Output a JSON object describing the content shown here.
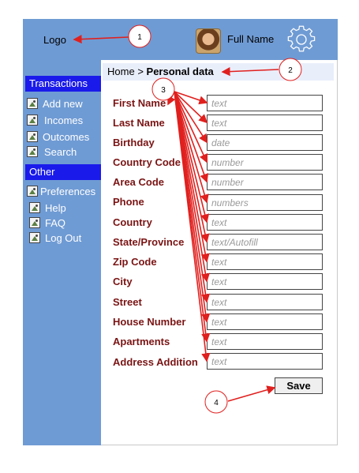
{
  "header": {
    "logo": "Logo",
    "user_name": "Full Name"
  },
  "sidebar": {
    "transactions_title": "Transactions",
    "transactions": [
      "Add new",
      "Incomes",
      "Outcomes",
      "Search"
    ],
    "other_title": "Other",
    "other": [
      "Preferences",
      "Help",
      "FAQ",
      "Log Out"
    ]
  },
  "breadcrumb": {
    "home": "Home",
    "separator": ">",
    "current": "Personal data"
  },
  "form": {
    "fields": [
      {
        "label": "First Name",
        "placeholder": "text"
      },
      {
        "label": "Last Name",
        "placeholder": "text"
      },
      {
        "label": "Birthday",
        "placeholder": "date"
      },
      {
        "label": "Country Code",
        "placeholder": "number"
      },
      {
        "label": "Area Code",
        "placeholder": "number"
      },
      {
        "label": "Phone",
        "placeholder": "numbers"
      },
      {
        "label": "Country",
        "placeholder": "text"
      },
      {
        "label": "State/Province",
        "placeholder": "text/Autofill"
      },
      {
        "label": "Zip Code",
        "placeholder": "text"
      },
      {
        "label": "City",
        "placeholder": "text"
      },
      {
        "label": "Street",
        "placeholder": "text"
      },
      {
        "label": "House Number",
        "placeholder": "text"
      },
      {
        "label": "Apartments",
        "placeholder": "text"
      },
      {
        "label": "Address Addition",
        "placeholder": "text"
      }
    ],
    "save_label": "Save"
  },
  "annotations": [
    "1",
    "2",
    "3",
    "4"
  ],
  "colors": {
    "header_bg": "#6f9bd4",
    "section_bg": "#1a1aeb",
    "label_color": "#7a1414",
    "annotation_red": "#e0201e"
  },
  "icons": {
    "settings": "gear-icon",
    "nav_item": "image-placeholder-icon"
  }
}
